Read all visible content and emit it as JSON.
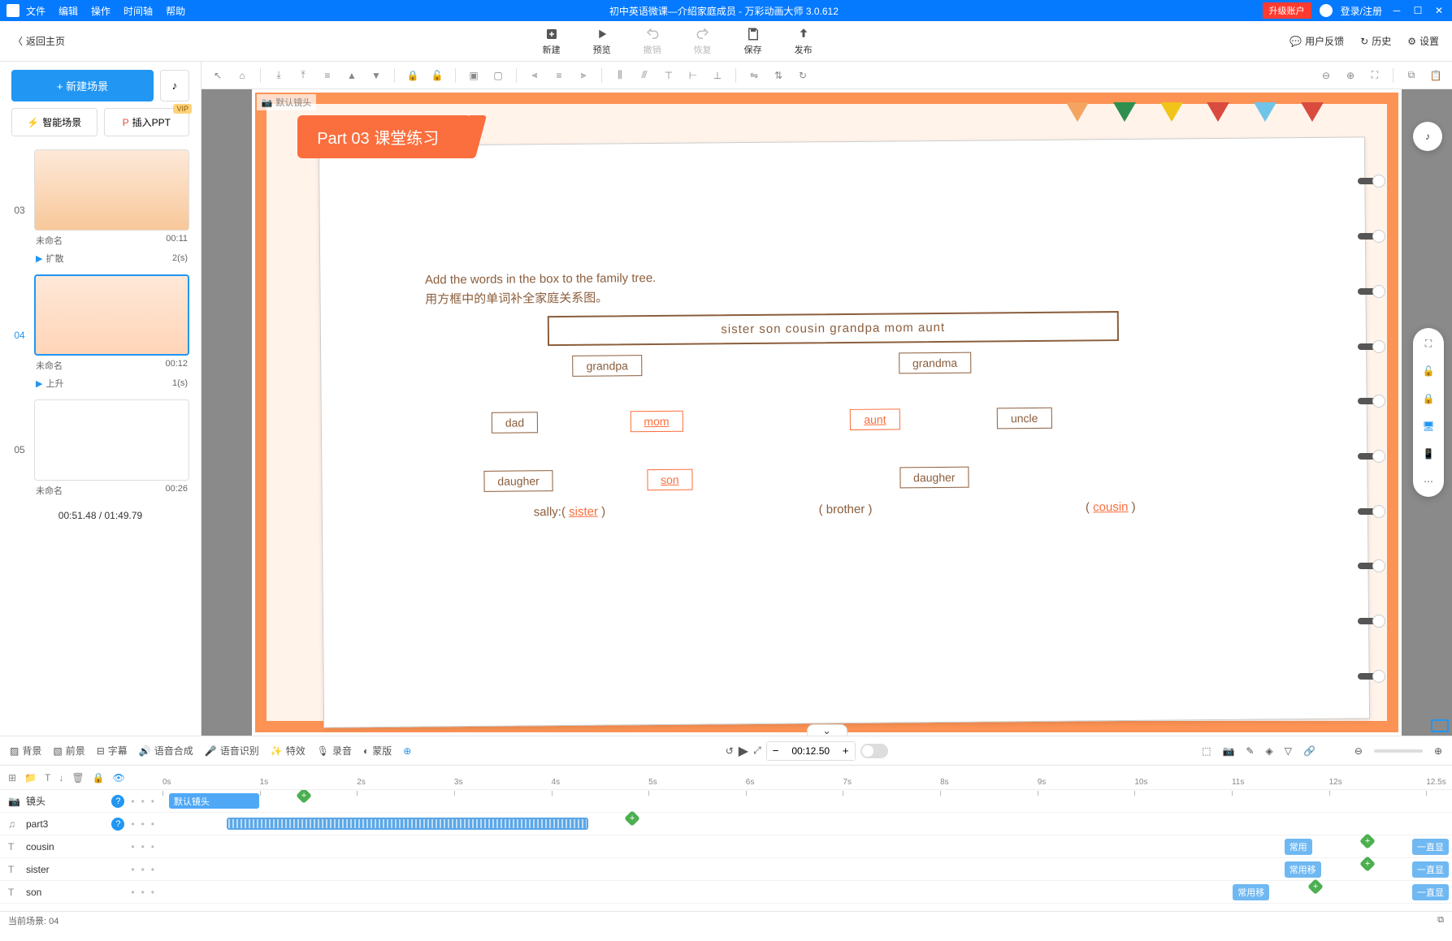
{
  "titlebar": {
    "menus": [
      "文件",
      "编辑",
      "操作",
      "时间轴",
      "帮助"
    ],
    "title": "初中英语微课—介绍家庭成员 - 万彩动画大师 3.0.612",
    "upgrade": "升级账户",
    "login": "登录/注册"
  },
  "back_home": "返回主页",
  "toolbar": {
    "new": "新建",
    "preview": "预览",
    "undo": "撤销",
    "redo": "恢复",
    "save": "保存",
    "publish": "发布"
  },
  "topright": {
    "feedback": "用户反馈",
    "history": "历史",
    "settings": "设置"
  },
  "left": {
    "new_scene": "+  新建场景",
    "smart_scene": "智能场景",
    "insert_ppt": "插入PPT",
    "vip": "VIP",
    "scenes": [
      {
        "num": "03",
        "name": "未命名",
        "time": "00:11",
        "trans": "扩散",
        "trans_t": "2(s)"
      },
      {
        "num": "04",
        "name": "未命名",
        "time": "00:12",
        "trans": "上升",
        "trans_t": "1(s)"
      },
      {
        "num": "05",
        "name": "未命名",
        "time": "00:26"
      }
    ],
    "timecounter": "00:51.48   / 01:49.79"
  },
  "slide": {
    "cam_label": "默认镜头",
    "banner": "Part 03  课堂练习",
    "instr_en": "Add the words in the box to the family tree.",
    "instr_cn": "用方框中的单词补全家庭关系图。",
    "wordbox": "sister   son   cousin   grandpa   mom   aunt",
    "nodes": {
      "grandpa": "grandpa",
      "grandma": "grandma",
      "dad": "dad",
      "mom": "mom",
      "aunt": "aunt",
      "uncle": "uncle",
      "daughter1": "daugher",
      "son": "son",
      "daughter2": "daugher"
    },
    "bottom": {
      "sally_label": "sally:(",
      "sister": "sister",
      "close1": ")",
      "brother": "(  brother  )",
      "open3": "(",
      "cousin": "cousin",
      "close3": ")"
    }
  },
  "bottombar": {
    "bg": "背景",
    "fg": "前景",
    "subtitle": "字幕",
    "tts": "语音合成",
    "asr": "语音识别",
    "fx": "特效",
    "record": "录音",
    "mask": "蒙版",
    "time": "00:12.50"
  },
  "timeline": {
    "ticks": [
      "0s",
      "1s",
      "2s",
      "3s",
      "4s",
      "5s",
      "6s",
      "7s",
      "8s",
      "9s",
      "10s",
      "11s",
      "12s",
      "12.5s"
    ],
    "tracks": [
      {
        "icon": "camera",
        "name": "镜头",
        "help": true
      },
      {
        "icon": "audio",
        "name": "part3",
        "help": true
      },
      {
        "icon": "text",
        "name": "cousin"
      },
      {
        "icon": "text",
        "name": "sister"
      },
      {
        "icon": "text",
        "name": "son"
      }
    ],
    "camera_clip": "默认镜头",
    "badge_common": "常用",
    "badge_move": "常用移",
    "badge_show": "一直显"
  },
  "status": {
    "current": "当前场景: 04"
  }
}
